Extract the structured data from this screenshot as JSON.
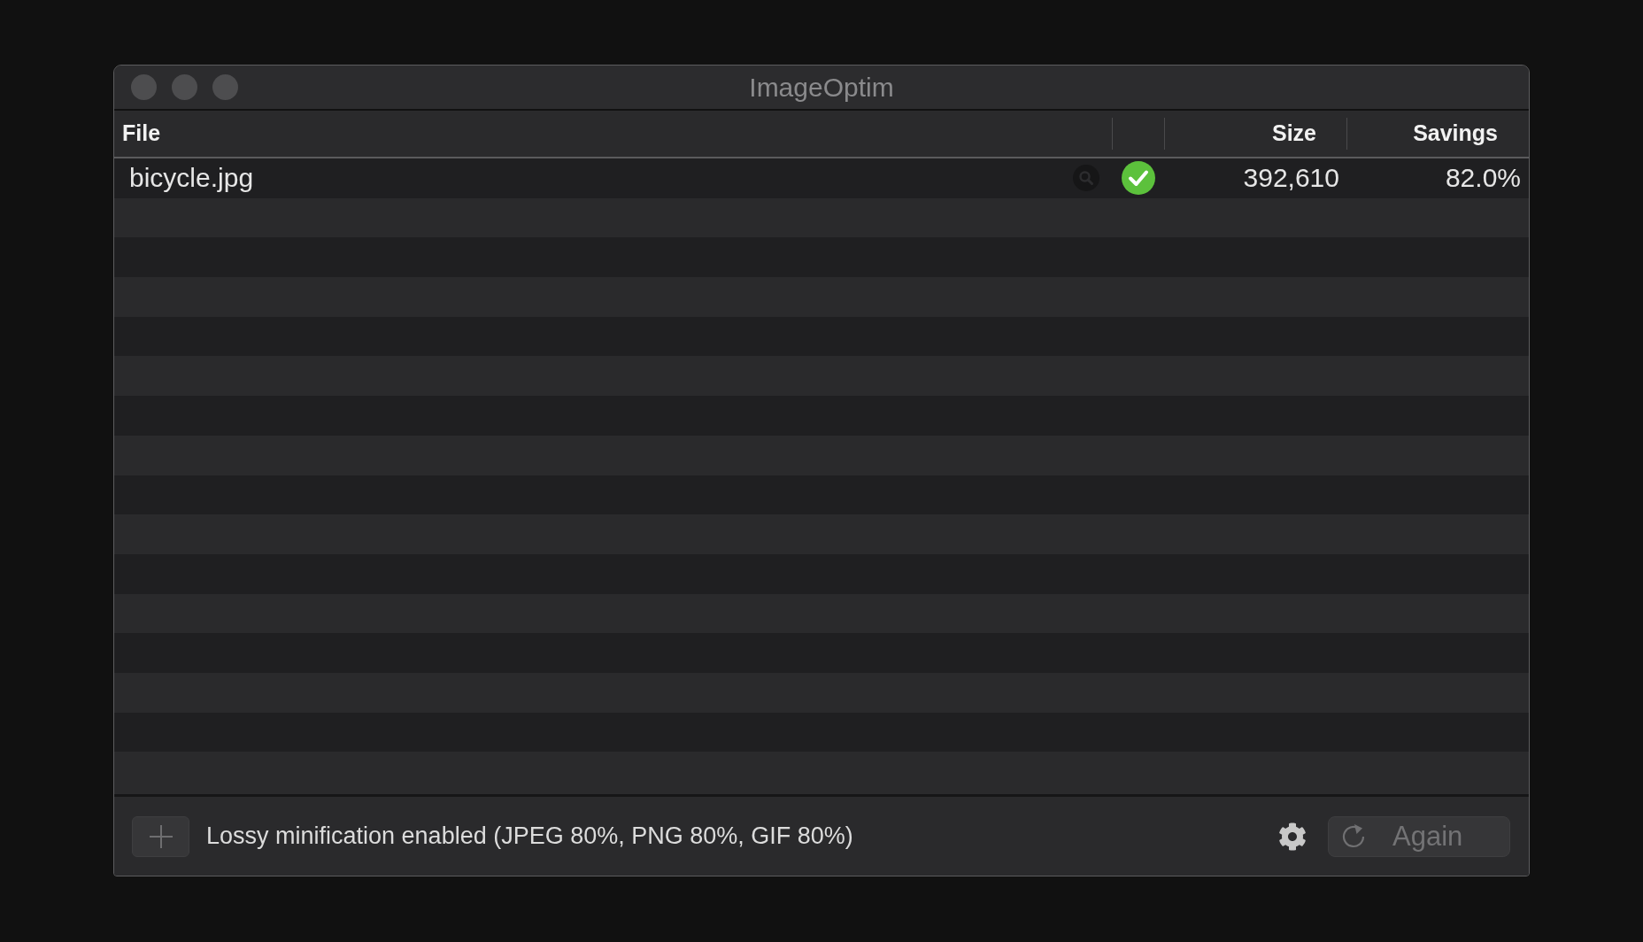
{
  "window": {
    "title": "ImageOptim"
  },
  "table": {
    "columns": {
      "file": "File",
      "size": "Size",
      "savings": "Savings"
    },
    "rows": [
      {
        "file": "bicycle.jpg",
        "optimized": true,
        "size": "392,610",
        "savings": "82.0%"
      }
    ]
  },
  "footer": {
    "message": "Lossy minification enabled (JPEG 80%, PNG 80%, GIF 80%)",
    "again_button": {
      "label": "Again",
      "disabled": true
    }
  }
}
